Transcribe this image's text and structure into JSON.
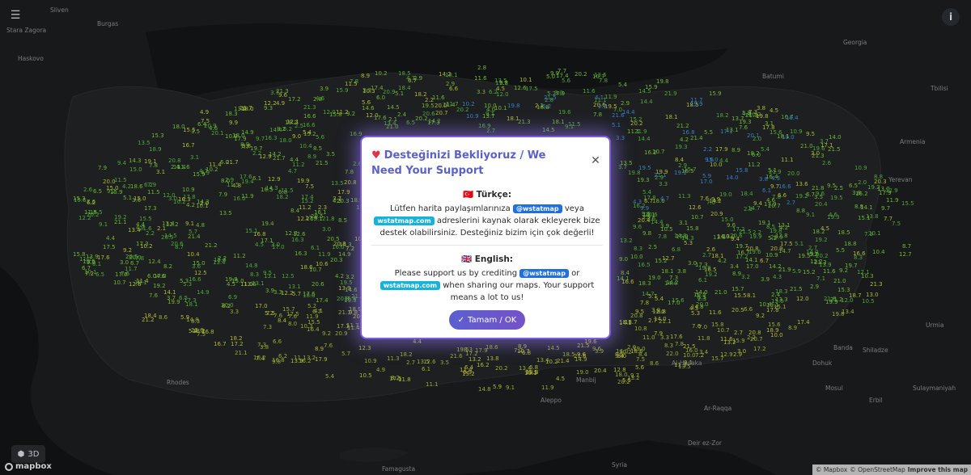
{
  "modal": {
    "title": "Desteğinizi Bekliyoruz / We Need Your Support",
    "tr_heading": "🇹🇷 Türkçe:",
    "tr_text_1": "Lütfen harita paylaşımlarınıza",
    "tr_pill_handle": "@wstatmap",
    "tr_text_2": "veya",
    "tr_pill_site": "wstatmap.com",
    "tr_text_3": "adreslerini kaynak olarak ekleyerek bize destek olabilirsiniz. Desteğiniz bizim için çok değerli!",
    "en_heading": "🇬🇧 English:",
    "en_text_1": "Please support us by crediting",
    "en_pill_handle": "@wstatmap",
    "en_text_2": "or",
    "en_pill_site": "wstatmap.com",
    "en_text_3": "when sharing our maps. Your support means a lot to us!",
    "ok_label": "Tamam / OK"
  },
  "controls": {
    "menu_icon": "hamburger-menu-icon",
    "info_icon": "info-icon",
    "btn_3d_label": "3D",
    "mapbox_logo": "mapbox"
  },
  "attribution": {
    "mapbox": "© Mapbox",
    "osm": "© OpenStreetMap",
    "improve": "Improve this map"
  },
  "place_labels": [
    {
      "text": "Sliven"
    },
    {
      "text": "Burgas"
    },
    {
      "text": "Stara Zagora"
    },
    {
      "text": "Haskovo"
    },
    {
      "text": "Batumi"
    },
    {
      "text": "Georgia"
    },
    {
      "text": "Tbilisi"
    },
    {
      "text": "Armenia"
    },
    {
      "text": "Yerevan"
    },
    {
      "text": "Aleppo"
    },
    {
      "text": "Mosul"
    },
    {
      "text": "Erbil"
    },
    {
      "text": "Sulaymaniyah"
    },
    {
      "text": "Al-Hasaka"
    },
    {
      "text": "Manbij"
    },
    {
      "text": "Rhodes"
    },
    {
      "text": "Famagusta"
    },
    {
      "text": "Syria"
    },
    {
      "text": "Deir ez-Zor"
    },
    {
      "text": "Ar-Raqqa"
    },
    {
      "text": "Banda"
    },
    {
      "text": "Shiladze"
    },
    {
      "text": "Urmia"
    },
    {
      "text": "Dohuk"
    }
  ],
  "colors": {
    "map_bg": "#161718",
    "land": "#1d1f21",
    "modal_border": "#7c5ce0",
    "title": "#5a62c7",
    "ok_button": "#6258cf",
    "pill_blue": "#1f6fe0",
    "pill_cyan": "#17b2d9"
  }
}
